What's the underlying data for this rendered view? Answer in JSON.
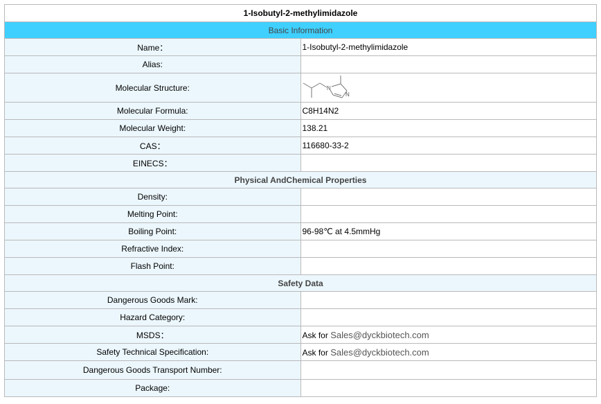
{
  "title": "1-Isobutyl-2-methylimidazole",
  "sections": {
    "basic": "Basic Information",
    "physical": "Physical AndChemical Properties",
    "safety": "Safety Data"
  },
  "basic_rows": {
    "name": {
      "label": "Name：",
      "value": "1-Isobutyl-2-methylimidazole"
    },
    "alias": {
      "label": "Alias:",
      "value": ""
    },
    "structure": {
      "label": "Molecular Structure:"
    },
    "formula": {
      "label": "Molecular Formula:",
      "value": "C8H14N2"
    },
    "weight": {
      "label": "Molecular Weight:",
      "value": "138.21"
    },
    "cas": {
      "label": "CAS：",
      "value": "116680-33-2"
    },
    "einecs": {
      "label": "EINECS：",
      "value": ""
    }
  },
  "physical_rows": {
    "density": {
      "label": "Density:",
      "value": ""
    },
    "melting": {
      "label": "Melting Point:",
      "value": ""
    },
    "boiling": {
      "label": "Boiling Point:",
      "value": "96-98℃ at 4.5mmHg"
    },
    "refractive": {
      "label": "Refractive Index:",
      "value": ""
    },
    "flash": {
      "label": "Flash Point:",
      "value": ""
    }
  },
  "safety_rows": {
    "dg_mark": {
      "label": "Dangerous Goods Mark:",
      "value": ""
    },
    "hazard": {
      "label": "Hazard Category:",
      "value": ""
    },
    "msds": {
      "label": "MSDS：",
      "prefix": "Ask for ",
      "email": "Sales@dyckbiotech.com"
    },
    "tech_spec": {
      "label": "Safety Technical Specification:",
      "prefix": "Ask for ",
      "email": "Sales@dyckbiotech.com"
    },
    "transport": {
      "label": "Dangerous Goods Transport Number:",
      "value": ""
    },
    "package": {
      "label": "Package:",
      "value": ""
    }
  },
  "structure_atom_label": "N"
}
